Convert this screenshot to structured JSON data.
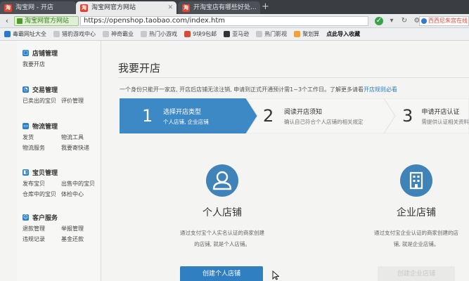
{
  "browser": {
    "tabs": [
      {
        "label": "淘宝网 - 开店",
        "active": false
      },
      {
        "label": "淘宝网官方网站",
        "active": true
      },
      {
        "label": "开淘宝店有哪些好处...",
        "active": false
      }
    ],
    "site_badge": "淘宝网官方网站",
    "url": "https://openshop.taobao.com/index.htm",
    "search_text": "西西尼朱宫在线",
    "bookmarks": [
      "毒霸网址大全",
      "猎豹游戏中心",
      "神奇霸业",
      "热门小游戏",
      "9块9包邮",
      "亚马逊",
      "热门影视",
      "聚划算",
      "点此导入收藏"
    ]
  },
  "sidebar": {
    "sections": [
      {
        "title": "店铺管理",
        "icon": "shop-icon",
        "links": [
          "我要开店"
        ]
      },
      {
        "title": "交易管理",
        "icon": "trade-icon",
        "links": [
          "已卖出的宝贝",
          "评价管理"
        ]
      },
      {
        "title": "物流管理",
        "icon": "truck-icon",
        "links": [
          "发货",
          "物流工具",
          "物流服务",
          "我要寄快递"
        ]
      },
      {
        "title": "宝贝管理",
        "icon": "goods-icon",
        "links": [
          "发布宝贝",
          "出售中的宝贝",
          "仓库中的宝贝",
          "体检中心"
        ]
      },
      {
        "title": "客户服务",
        "icon": "service-icon",
        "links": [
          "退款管理",
          "举报管理",
          "违规记录",
          "基金还款"
        ]
      }
    ]
  },
  "main": {
    "title": "我要开店",
    "notice_text": "一个身份只能开一家店, 开店后店铺无法注销, 申请到正式开通预计需1~3个工作日。了解更多请看",
    "notice_link": "开店规则必看",
    "steps": [
      {
        "num": "1",
        "title": "选择开店类型",
        "desc": "个人店铺, 企业店铺",
        "active": true
      },
      {
        "num": "2",
        "title": "阅读开店须知",
        "desc": "确认自己符合个人店铺的相关规定",
        "active": false
      },
      {
        "num": "3",
        "title": "申请开店认证",
        "desc": "需提供认证相关资料",
        "active": false
      }
    ],
    "cards": [
      {
        "name": "个人店铺",
        "icon": "person-icon",
        "desc1": "通过支付宝个人实名认证的商家创建",
        "desc2": "的店铺, 就是个人店铺。",
        "button": "创建个人店铺"
      },
      {
        "name": "企业店铺",
        "icon": "building-icon",
        "desc1": "通过支付宝企业认证的商家创建的店",
        "desc2": "铺, 就是企业店铺。",
        "button": "创建企业店铺"
      }
    ]
  },
  "colors": {
    "accent": "#2f7fc1",
    "step_active": "#3d89c6",
    "step_inactive": "#f5f5f5"
  }
}
